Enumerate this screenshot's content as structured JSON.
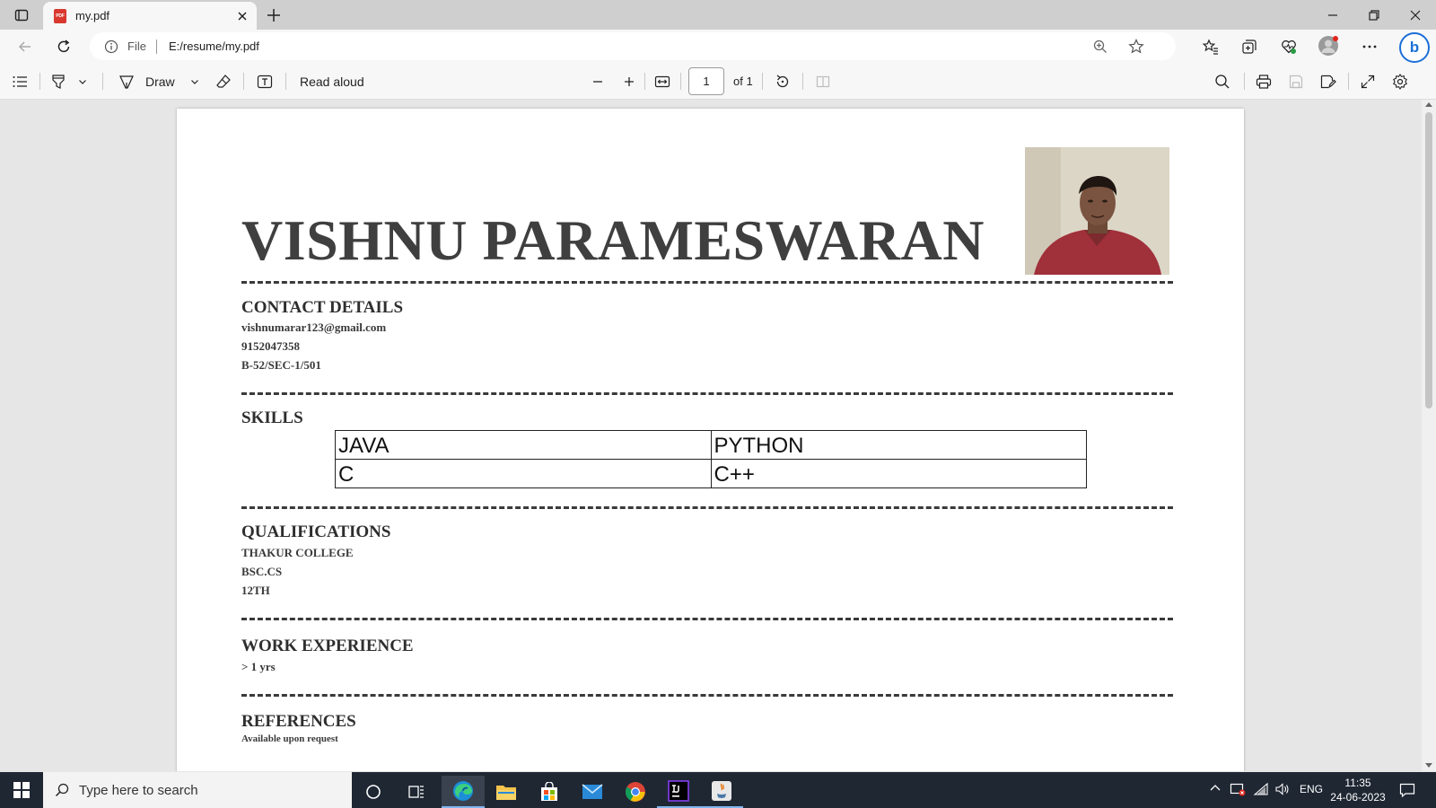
{
  "browser": {
    "tab": {
      "title": "my.pdf",
      "favicon_text": "PDF"
    },
    "address": {
      "scheme_label": "File",
      "url": "E:/resume/my.pdf"
    },
    "bing_label": "b"
  },
  "pdf_toolbar": {
    "draw_label": "Draw",
    "read_aloud_label": "Read aloud",
    "page_number": "1",
    "page_of": "of 1"
  },
  "resume": {
    "name": "VISHNU PARAMESWARAN",
    "contact": {
      "title": "CONTACT DETAILS",
      "email": "vishnumarar123@gmail.com",
      "phone": "9152047358",
      "address": "B-52/SEC-1/501"
    },
    "skills": {
      "title": "SKILLS",
      "rows": [
        [
          "JAVA",
          "PYTHON"
        ],
        [
          "C",
          "C++"
        ]
      ]
    },
    "qualifications": {
      "title": "QUALIFICATIONS",
      "items": [
        "THAKUR COLLEGE",
        "BSC.CS",
        "12TH"
      ]
    },
    "work": {
      "title": "WORK EXPERIENCE",
      "value": "> 1 yrs"
    },
    "references": {
      "title": "REFERENCES",
      "value": "Available upon request"
    }
  },
  "taskbar": {
    "search_placeholder": "Type here to search",
    "language": "ENG",
    "time": "11:35",
    "date": "24-06-2023"
  }
}
